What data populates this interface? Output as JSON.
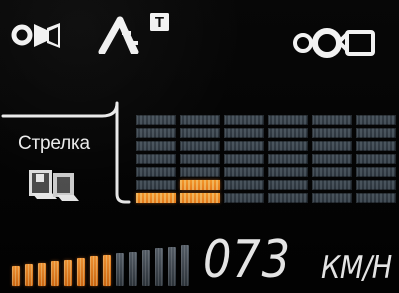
{
  "status_icons": {
    "left": "camera-icon",
    "middle": "road-lane-icon",
    "middle_badge": "T",
    "right": "rear-camera-icon"
  },
  "mode_panel": {
    "label": "Стрелка",
    "icon": "speed-camera-mode-icon"
  },
  "signal_bars": {
    "columns": [
      {
        "active": 1
      },
      {
        "active": 2
      },
      {
        "active": 0
      },
      {
        "active": 0
      },
      {
        "active": 0
      },
      {
        "active": 0
      }
    ]
  },
  "speed": {
    "value": "073",
    "unit": "КМ/Н",
    "meter_total": 14,
    "meter_active": 8
  },
  "colors": {
    "text": "#f5f5f5",
    "active": "#ff8d24",
    "inactive": "#323b44"
  }
}
